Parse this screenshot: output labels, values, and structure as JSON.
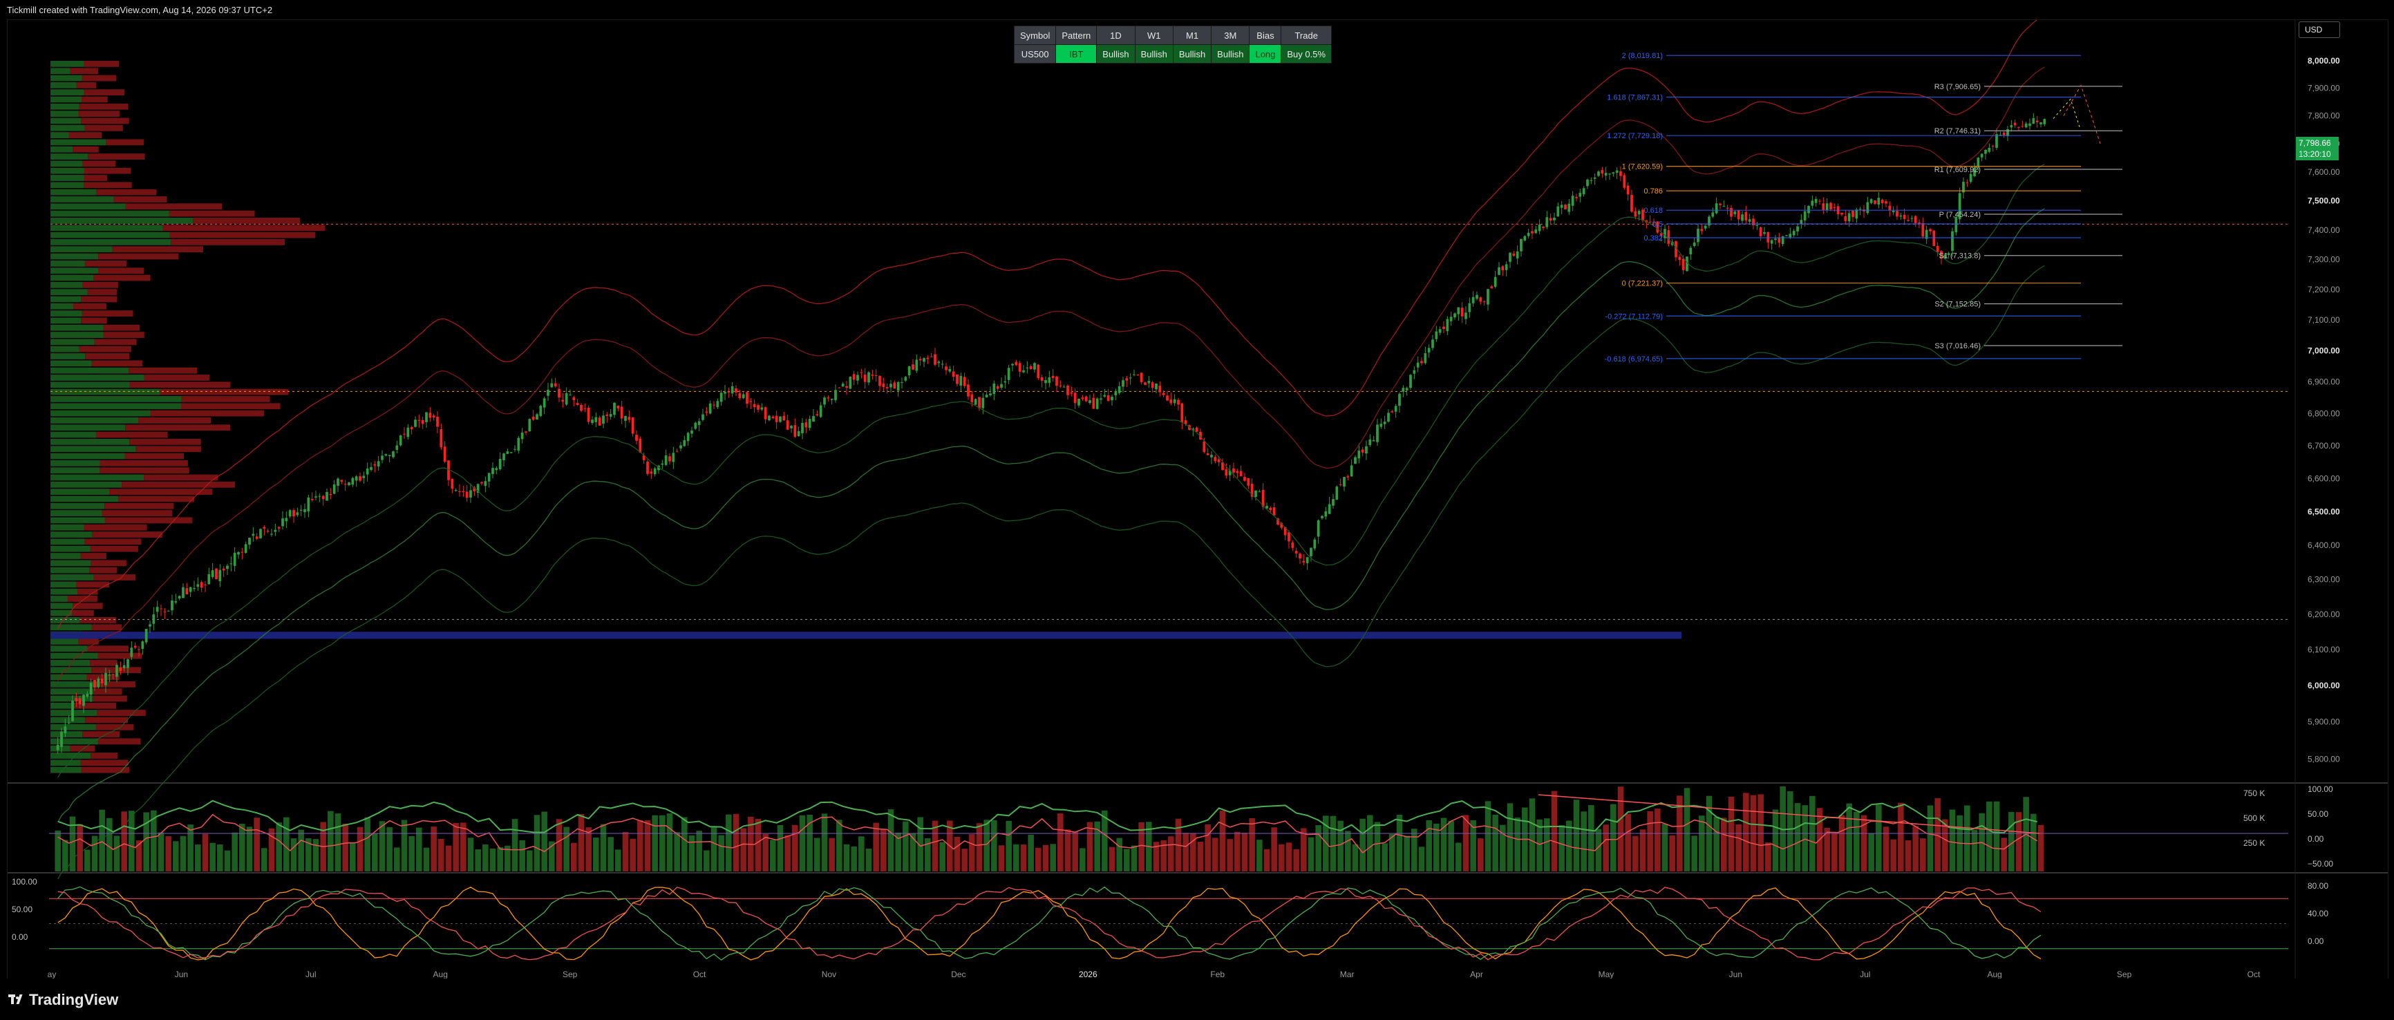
{
  "header": {
    "credit": "Tickmill created with TradingView.com, Aug 14, 2026 09:37 UTC+2"
  },
  "footer": {
    "brand": "TradingView"
  },
  "currency": "USD",
  "current_price": {
    "value": "7,798.66",
    "countdown": "13:20:10"
  },
  "signal_table": {
    "headers": [
      "Symbol",
      "Pattern",
      "1D",
      "W1",
      "M1",
      "3M",
      "Bias",
      "Trade"
    ],
    "values": [
      "US500",
      "IBT",
      "Bullish",
      "Bullish",
      "Bullish",
      "Bullish",
      "Long",
      "Buy 0.5%"
    ]
  },
  "colors": {
    "background": "#000000",
    "bull": "#2e9e3e",
    "bear": "#ff1f1f",
    "fib": "#2962ff",
    "fib_key": "#ff9800",
    "pivot": "#9e9e9e",
    "band_outer": "#b71c1c",
    "band_inner": "#1b5e20"
  },
  "chart_data": [
    {
      "type": "line",
      "name": "price",
      "y_ticks": [
        "8,000.00",
        "7,900.00",
        "7,800.00",
        "7,700.00",
        "7,600.00",
        "7,500.00",
        "7,400.00",
        "7,300.00",
        "7,200.00",
        "7,100.00",
        "7,000.00",
        "6,900.00",
        "6,800.00",
        "6,700.00",
        "6,600.00",
        "6,500.00",
        "6,400.00",
        "6,300.00",
        "6,200.00",
        "6,100.00",
        "6,000.00",
        "5,900.00",
        "5,800.00"
      ],
      "x_ticks": [
        "ay",
        "Jun",
        "Jul",
        "Aug",
        "Sep",
        "Oct",
        "Nov",
        "Dec",
        "2026",
        "Feb",
        "Mar",
        "Apr",
        "May",
        "Jun",
        "Jul",
        "Aug",
        "Sep",
        "Oct"
      ],
      "ylim": [
        5740,
        8105
      ],
      "log_scale": true,
      "price_path": [
        5850,
        5950,
        6000,
        6020,
        6060,
        6120,
        6220,
        6230,
        6280,
        6300,
        6330,
        6380,
        6420,
        6450,
        6480,
        6520,
        6540,
        6580,
        6600,
        6620,
        6680,
        6720,
        6780,
        6800,
        6550,
        6560,
        6600,
        6660,
        6720,
        6800,
        6880,
        6850,
        6800,
        6780,
        6820,
        6760,
        6620,
        6650,
        6720,
        6790,
        6830,
        6880,
        6840,
        6800,
        6780,
        6740,
        6800,
        6860,
        6900,
        6920,
        6900,
        6870,
        6950,
        6980,
        6960,
        6900,
        6820,
        6880,
        6940,
        6960,
        6920,
        6900,
        6850,
        6820,
        6860,
        6900,
        6910,
        6880,
        6830,
        6750,
        6680,
        6620,
        6600,
        6550,
        6500,
        6420,
        6350,
        6500,
        6580,
        6650,
        6720,
        6800,
        6880,
        6960,
        7050,
        7110,
        7150,
        7180,
        7280,
        7350,
        7400,
        7450,
        7500,
        7550,
        7600,
        7620,
        7460,
        7420,
        7380,
        7280,
        7400,
        7480,
        7460,
        7420,
        7380,
        7360,
        7430,
        7500,
        7470,
        7440,
        7480,
        7500,
        7460,
        7420,
        7380,
        7300,
        7550,
        7650,
        7720,
        7760,
        7780,
        7800
      ],
      "fib_levels": [
        {
          "label": "2 (8,019.81)",
          "value": 8019.81,
          "key": false
        },
        {
          "label": "1.618 (7,867.31)",
          "value": 7867.31,
          "key": false
        },
        {
          "label": "1.272 (7,729.18)",
          "value": 7729.18,
          "key": false
        },
        {
          "label": "1 (7,620.59)",
          "value": 7620.59,
          "key": true
        },
        {
          "label": "0.786",
          "value": 7535,
          "key": true
        },
        {
          "label": "0.618",
          "value": 7468,
          "key": false
        },
        {
          "label": "0.5",
          "value": 7421,
          "key": false
        },
        {
          "label": "0.382",
          "value": 7374,
          "key": false
        },
        {
          "label": "0 (7,221.37)",
          "value": 7221.37,
          "key": true
        },
        {
          "label": "-0.272 (7,112.79)",
          "value": 7112.79,
          "key": false
        },
        {
          "label": "-0.618 (6,974.65)",
          "value": 6974.65,
          "key": false
        }
      ],
      "pivots": [
        {
          "label": "R3 (7,906.65)",
          "value": 7906.65
        },
        {
          "label": "R2 (7,746.31)",
          "value": 7746.31
        },
        {
          "label": "R1 (7,609.92)",
          "value": 7609.92
        },
        {
          "label": "P (7,454.24)",
          "value": 7454.24
        },
        {
          "label": "S1 (7,313.8)",
          "value": 7313.8
        },
        {
          "label": "S2 (7,152.85)",
          "value": 7152.85
        },
        {
          "label": "S3 (7,016.46)",
          "value": 7016.46
        }
      ],
      "horizontal_levels": [
        7420,
        6870,
        6185
      ],
      "support_zone": [
        6130,
        6150
      ]
    },
    {
      "type": "bar",
      "name": "volume",
      "y_ticks_left": [
        "750 K",
        "500 K",
        "250 K"
      ],
      "y_ticks_right": [
        "100.00",
        "50.00",
        "0.00",
        "−50.00"
      ]
    },
    {
      "type": "line",
      "name": "stochastic",
      "y_ticks_left": [
        "100.00",
        "50.00",
        "0.00"
      ],
      "y_ticks_right": [
        "80.00",
        "40.00",
        "0.00"
      ],
      "ylim": [
        0,
        100
      ],
      "overbought": 80,
      "oversold": 20
    }
  ]
}
